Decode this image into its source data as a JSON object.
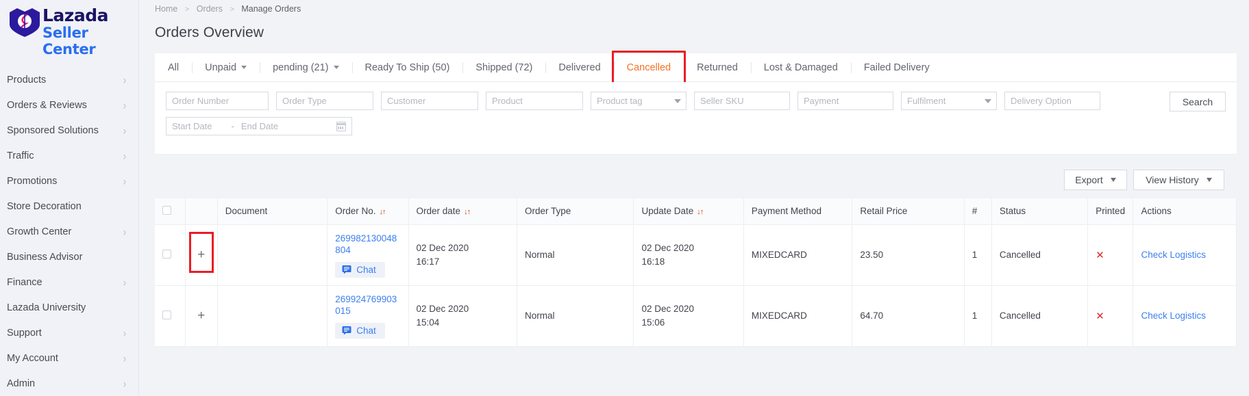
{
  "brand": {
    "name": "Lazada",
    "subtitle": "Seller Center",
    "logo_icon": "lazada-heart-logo"
  },
  "sidebar": {
    "items": [
      {
        "label": "Products",
        "has_chevron": true
      },
      {
        "label": "Orders & Reviews",
        "has_chevron": true
      },
      {
        "label": "Sponsored Solutions",
        "has_chevron": true
      },
      {
        "label": "Traffic",
        "has_chevron": true
      },
      {
        "label": "Promotions",
        "has_chevron": true
      },
      {
        "label": "Store Decoration",
        "has_chevron": false
      },
      {
        "label": "Growth Center",
        "has_chevron": true
      },
      {
        "label": "Business Advisor",
        "has_chevron": false
      },
      {
        "label": "Finance",
        "has_chevron": true
      },
      {
        "label": "Lazada University",
        "has_chevron": false
      },
      {
        "label": "Support",
        "has_chevron": true
      },
      {
        "label": "My Account",
        "has_chevron": true
      },
      {
        "label": "Admin",
        "has_chevron": true
      }
    ]
  },
  "breadcrumb": {
    "home": "Home",
    "section": "Orders",
    "current": "Manage Orders",
    "separator": ">"
  },
  "page_title": "Orders Overview",
  "tabs": [
    {
      "label": "All",
      "caret": false,
      "active": false
    },
    {
      "label": "Unpaid",
      "caret": true,
      "active": false
    },
    {
      "label": "pending (21)",
      "caret": true,
      "active": false
    },
    {
      "label": "Ready To Ship (50)",
      "caret": false,
      "active": false
    },
    {
      "label": "Shipped (72)",
      "caret": false,
      "active": false
    },
    {
      "label": "Delivered",
      "caret": false,
      "active": false
    },
    {
      "label": "Cancelled",
      "caret": false,
      "active": true
    },
    {
      "label": "Returned",
      "caret": false,
      "active": false
    },
    {
      "label": "Lost & Damaged",
      "caret": false,
      "active": false
    },
    {
      "label": "Failed Delivery",
      "caret": false,
      "active": false
    }
  ],
  "filters": {
    "order_number": {
      "placeholder": "Order Number",
      "value": ""
    },
    "order_type": {
      "placeholder": "Order Type",
      "value": ""
    },
    "customer": {
      "placeholder": "Customer",
      "value": ""
    },
    "product": {
      "placeholder": "Product",
      "value": ""
    },
    "product_tag": {
      "placeholder": "Product tag",
      "value": ""
    },
    "seller_sku": {
      "placeholder": "Seller SKU",
      "value": ""
    },
    "payment": {
      "placeholder": "Payment",
      "value": ""
    },
    "fulfilment": {
      "placeholder": "Fulfilment",
      "value": ""
    },
    "delivery_option": {
      "placeholder": "Delivery Option",
      "value": ""
    },
    "start_date": {
      "placeholder": "Start Date",
      "value": ""
    },
    "end_date": {
      "placeholder": "End Date",
      "value": ""
    },
    "date_separator": "-",
    "search_label": "Search"
  },
  "toolbar": {
    "export_label": "Export",
    "view_history_label": "View History"
  },
  "table": {
    "columns": [
      {
        "label": "",
        "key": "checkbox"
      },
      {
        "label": "",
        "key": "expand"
      },
      {
        "label": "Document",
        "sortable": false
      },
      {
        "label": "Order No.",
        "sortable": true
      },
      {
        "label": "Order date",
        "sortable": true
      },
      {
        "label": "Order Type",
        "sortable": false
      },
      {
        "label": "Update Date",
        "sortable": true
      },
      {
        "label": "Payment Method",
        "sortable": false
      },
      {
        "label": "Retail Price",
        "sortable": false
      },
      {
        "label": "#",
        "sortable": false
      },
      {
        "label": "Status",
        "sortable": false
      },
      {
        "label": "Printed",
        "sortable": false
      },
      {
        "label": "Actions",
        "sortable": false
      }
    ],
    "sort_glyph": "↓↑",
    "expand_glyph": "+",
    "chat_label": "Chat",
    "printed_glyph": "✕",
    "rows": [
      {
        "order_no": "269982130048804",
        "order_date": "02 Dec 2020",
        "order_time": "16:17",
        "order_type": "Normal",
        "update_date": "02 Dec 2020",
        "update_time": "16:18",
        "payment_method": "MIXEDCARD",
        "retail_price": "23.50",
        "qty": "1",
        "status": "Cancelled",
        "action": "Check Logistics"
      },
      {
        "order_no": "269924769903015",
        "order_date": "02 Dec 2020",
        "order_time": "15:04",
        "order_type": "Normal",
        "update_date": "02 Dec 2020",
        "update_time": "15:06",
        "payment_method": "MIXEDCARD",
        "retail_price": "64.70",
        "qty": "1",
        "status": "Cancelled",
        "action": "Check Logistics"
      }
    ]
  },
  "annotations": {
    "tab_highlight": "Cancelled",
    "cell_highlight": "expand-row-1",
    "color": "#ec1c24"
  },
  "colors": {
    "accent_orange": "#f57224",
    "link_blue": "#3b7ff0",
    "brand_navy": "#1b1464",
    "brand_blue": "#2a6ef0",
    "danger_red": "#d9302c"
  }
}
